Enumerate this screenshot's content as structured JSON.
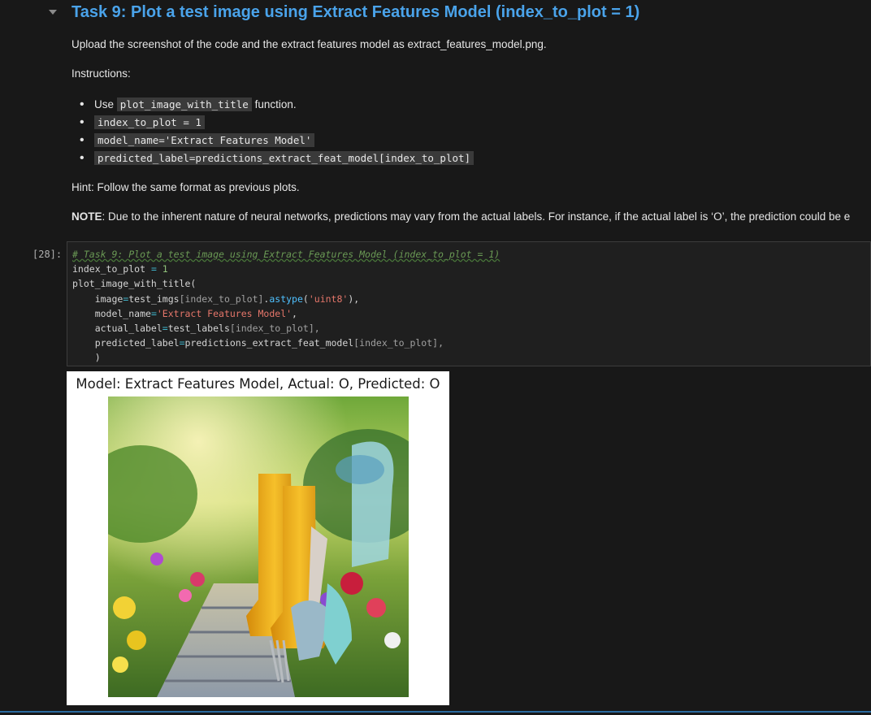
{
  "markdown": {
    "heading": "Task 9: Plot a test image using Extract Features Model (index_to_plot = 1)",
    "upload_text": "Upload the screenshot of the code and the extract features model as extract_features_model.png.",
    "instructions_label": "Instructions:",
    "items": [
      {
        "prefix": "Use ",
        "code": "plot_image_with_title",
        "suffix": " function."
      },
      {
        "prefix": "",
        "code": "index_to_plot = 1",
        "suffix": ""
      },
      {
        "prefix": "",
        "code": "model_name='Extract Features Model'",
        "suffix": ""
      },
      {
        "prefix": "",
        "code": "predicted_label=predictions_extract_feat_model[index_to_plot]",
        "suffix": ""
      }
    ],
    "hint": "Hint: Follow the same format as previous plots.",
    "note_label": "NOTE",
    "note_text": ": Due to the inherent nature of neural networks, predictions may vary from the actual labels. For instance, if the actual label is ‘O’, the prediction could be e"
  },
  "code_cell": {
    "exec_count": "[28]:",
    "comment": "# Task 9: Plot a test image using Extract Features Model (index_to_plot = 1)",
    "l2_var": "index_to_plot",
    "l2_op": " = ",
    "l2_num": "1",
    "l3": "plot_image_with_title(",
    "l4_a": "    image",
    "l4_op": "=",
    "l4_b": "test_imgs",
    "l4_c": "[index_to_plot]",
    "l4_d": ".",
    "l4_e": "astype",
    "l4_f": "(",
    "l4_str": "'uint8'",
    "l4_g": "),",
    "l5_a": "    model_name",
    "l5_op": "=",
    "l5_str": "'Extract Features Model'",
    "l5_g": ",",
    "l6_a": "    actual_label",
    "l6_op": "=",
    "l6_b": "test_labels",
    "l6_c": "[index_to_plot],",
    "l7_a": "    predicted_label",
    "l7_op": "=",
    "l7_b": "predictions_extract_feat_model",
    "l7_c": "[index_to_plot],",
    "l8": "    )"
  },
  "output": {
    "figure_title": "Model: Extract Features Model, Actual: O, Predicted: O",
    "image_subject": "garden-boots-and-tools-photo"
  },
  "colors": {
    "heading": "#4aa3ea",
    "background": "#181818",
    "code_bg": "#1f1f1f"
  }
}
